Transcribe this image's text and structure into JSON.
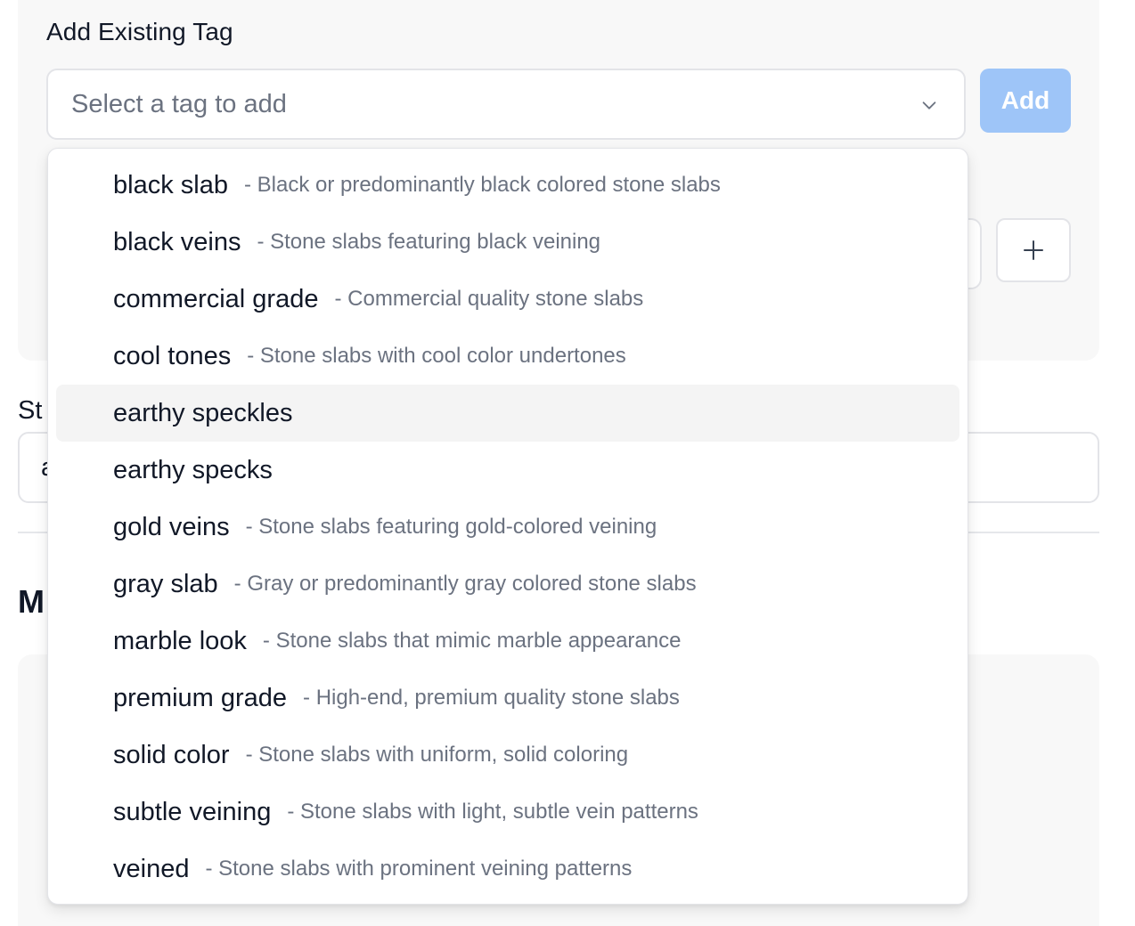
{
  "add_tag": {
    "title": "Add Existing Tag",
    "select_placeholder": "Select a tag to add",
    "add_button_label": "Add",
    "plus_symbol": "+"
  },
  "partial_field": {
    "label": "St",
    "value": "a"
  },
  "partial_heading": "M",
  "dropdown": {
    "highlighted_index": 4,
    "options": [
      {
        "name": "black slab",
        "description": "- Black or predominantly black colored stone slabs"
      },
      {
        "name": "black veins",
        "description": "- Stone slabs featuring black veining"
      },
      {
        "name": "commercial grade",
        "description": "- Commercial quality stone slabs"
      },
      {
        "name": "cool tones",
        "description": "- Stone slabs with cool color undertones"
      },
      {
        "name": "earthy speckles",
        "description": ""
      },
      {
        "name": "earthy specks",
        "description": ""
      },
      {
        "name": "gold veins",
        "description": "- Stone slabs featuring gold-colored veining"
      },
      {
        "name": "gray slab",
        "description": "- Gray or predominantly gray colored stone slabs"
      },
      {
        "name": "marble look",
        "description": "- Stone slabs that mimic marble appearance"
      },
      {
        "name": "premium grade",
        "description": "- High-end, premium quality stone slabs"
      },
      {
        "name": "solid color",
        "description": "- Stone slabs with uniform, solid coloring"
      },
      {
        "name": "subtle veining",
        "description": "- Stone slabs with light, subtle vein patterns"
      },
      {
        "name": "veined",
        "description": "- Stone slabs with prominent veining patterns"
      }
    ]
  },
  "colors": {
    "primary_disabled": "#9ec5f8",
    "card_background": "#f8f8f8",
    "highlight_background": "#f4f4f4",
    "muted_text": "#6b7280"
  }
}
